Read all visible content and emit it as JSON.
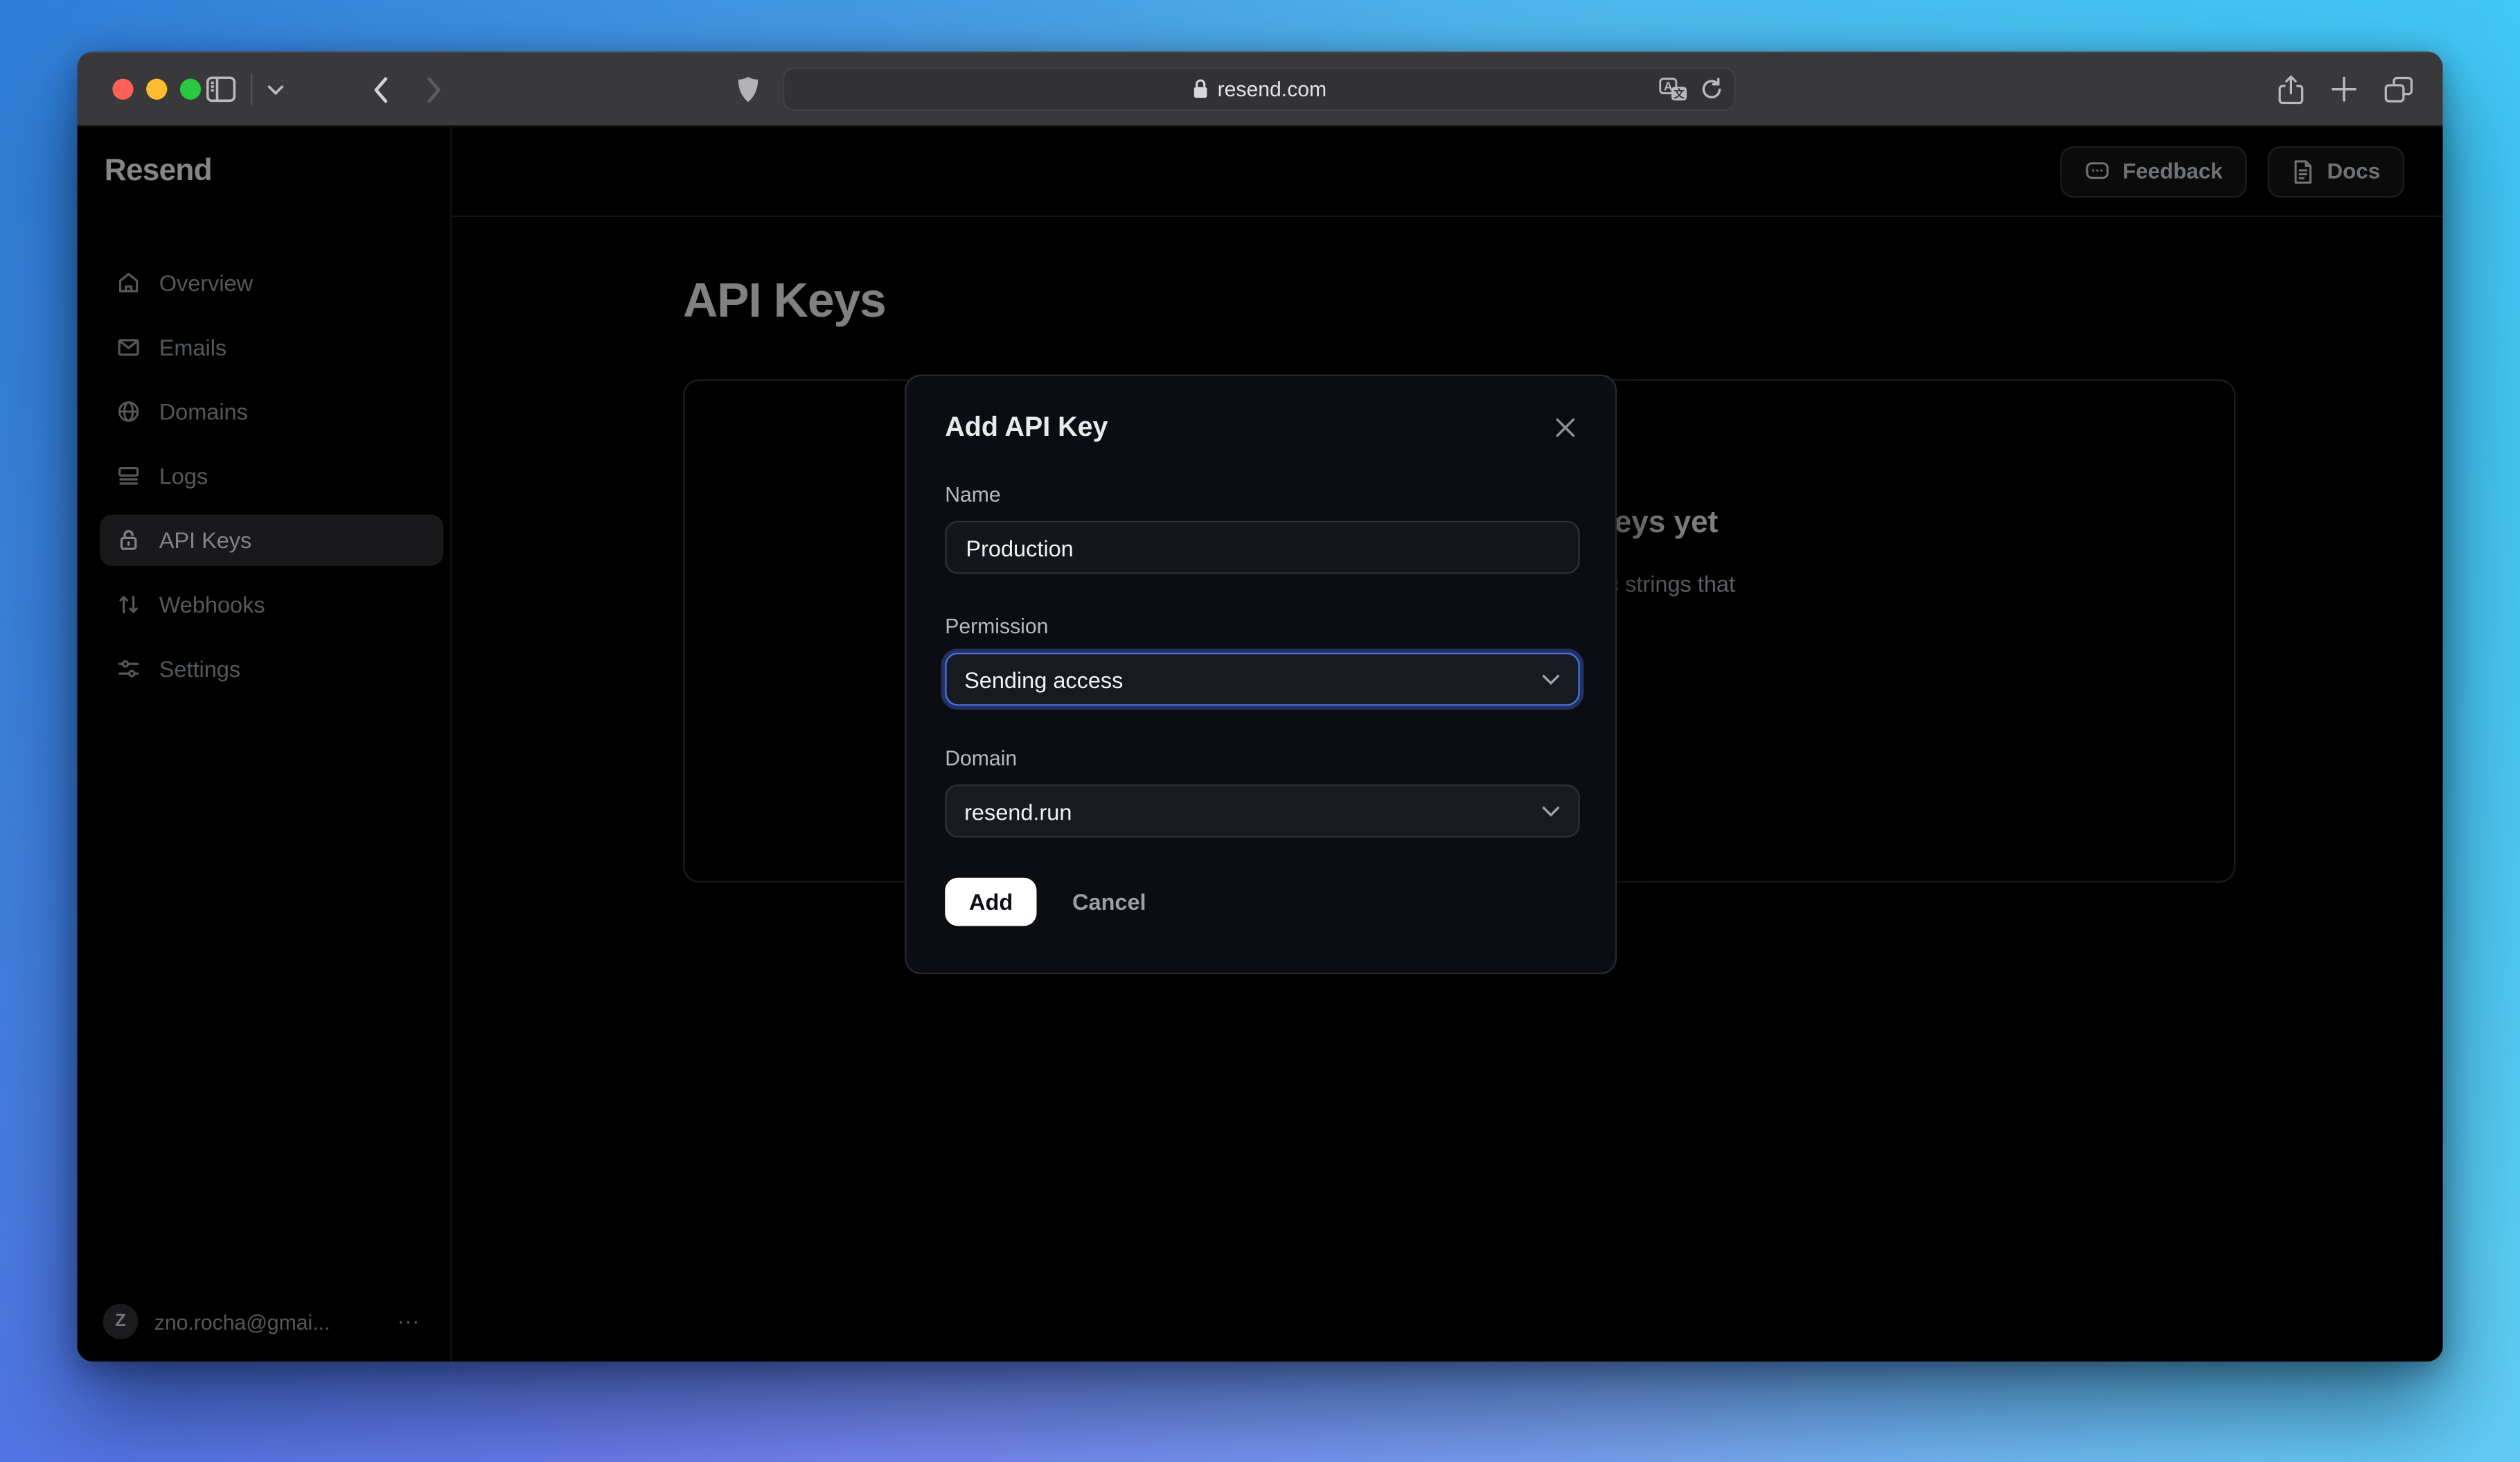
{
  "browser": {
    "url": "resend.com"
  },
  "header": {
    "feedback_label": "Feedback",
    "docs_label": "Docs"
  },
  "sidebar": {
    "logo": "Resend",
    "items": [
      {
        "label": "Overview",
        "selected": false
      },
      {
        "label": "Emails",
        "selected": false
      },
      {
        "label": "Domains",
        "selected": false
      },
      {
        "label": "Logs",
        "selected": false
      },
      {
        "label": "API Keys",
        "selected": true
      },
      {
        "label": "Webhooks",
        "selected": false
      },
      {
        "label": "Settings",
        "selected": false
      }
    ],
    "user": {
      "initial": "Z",
      "email": "zno.rocha@gmai...",
      "menu": "⋯"
    }
  },
  "page": {
    "title": "API Keys",
    "empty_state": {
      "heading": "No API Keys yet",
      "description": "API keys are alphanumeric strings that"
    }
  },
  "modal": {
    "title": "Add API Key",
    "name_label": "Name",
    "name_value": "Production",
    "permission_label": "Permission",
    "permission_value": "Sending access",
    "domain_label": "Domain",
    "domain_value": "resend.run",
    "add_label": "Add",
    "cancel_label": "Cancel"
  },
  "colors": {
    "focus_ring": "#4a72e0",
    "traffic_close": "#ff5f57",
    "traffic_minimize": "#febc2e",
    "traffic_zoom": "#28c840"
  }
}
